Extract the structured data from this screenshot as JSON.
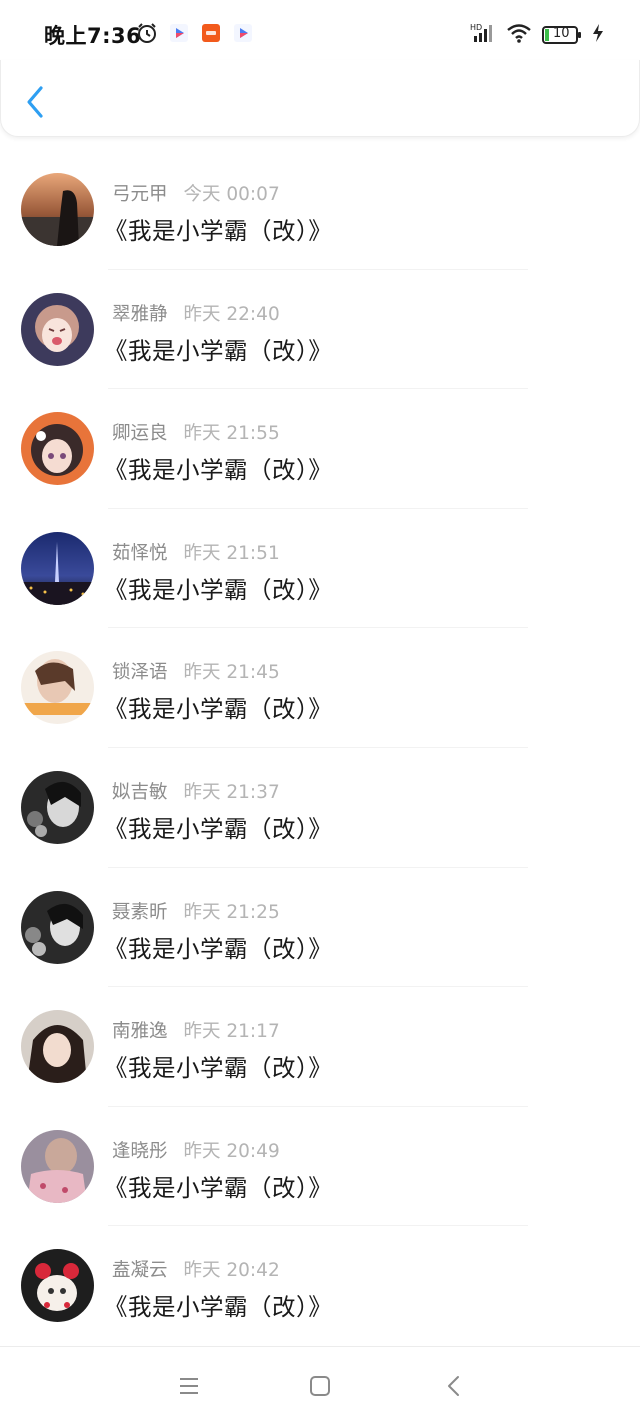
{
  "status_bar": {
    "time": "晚上7:36",
    "left_icons": [
      "alarm-icon",
      "video-app-icon",
      "taobao-app-icon",
      "video-app-icon"
    ],
    "right_icons": [
      "hd-signal-icon",
      "wifi-icon",
      "battery-icon",
      "charging-icon"
    ],
    "battery_label": "10"
  },
  "header": {
    "back_icon": "chevron-left-icon",
    "accent_color": "#2e9ff2"
  },
  "messages": [
    {
      "name": "弓元甲",
      "time": "今天 00:07",
      "text": "《我是小学霸（改）》"
    },
    {
      "name": "翠雅静",
      "time": "昨天 22:40",
      "text": "《我是小学霸（改）》"
    },
    {
      "name": "卿运良",
      "time": "昨天 21:55",
      "text": "《我是小学霸（改）》"
    },
    {
      "name": "茹怿悦",
      "time": "昨天 21:51",
      "text": "《我是小学霸（改）》"
    },
    {
      "name": "锁泽语",
      "time": "昨天 21:45",
      "text": "《我是小学霸（改）》"
    },
    {
      "name": "姒吉敏",
      "time": "昨天 21:37",
      "text": "《我是小学霸（改）》"
    },
    {
      "name": "聂素昕",
      "time": "昨天 21:25",
      "text": "《我是小学霸（改）》"
    },
    {
      "name": "南雅逸",
      "time": "昨天 21:17",
      "text": "《我是小学霸（改）》"
    },
    {
      "name": "逢晓彤",
      "time": "昨天 20:49",
      "text": "《我是小学霸（改）》"
    },
    {
      "name": "盍凝云",
      "time": "昨天 20:42",
      "text": "《我是小学霸（改）》"
    }
  ],
  "nav_bar": {
    "icons": [
      "menu-icon",
      "home-icon",
      "back-icon"
    ]
  }
}
